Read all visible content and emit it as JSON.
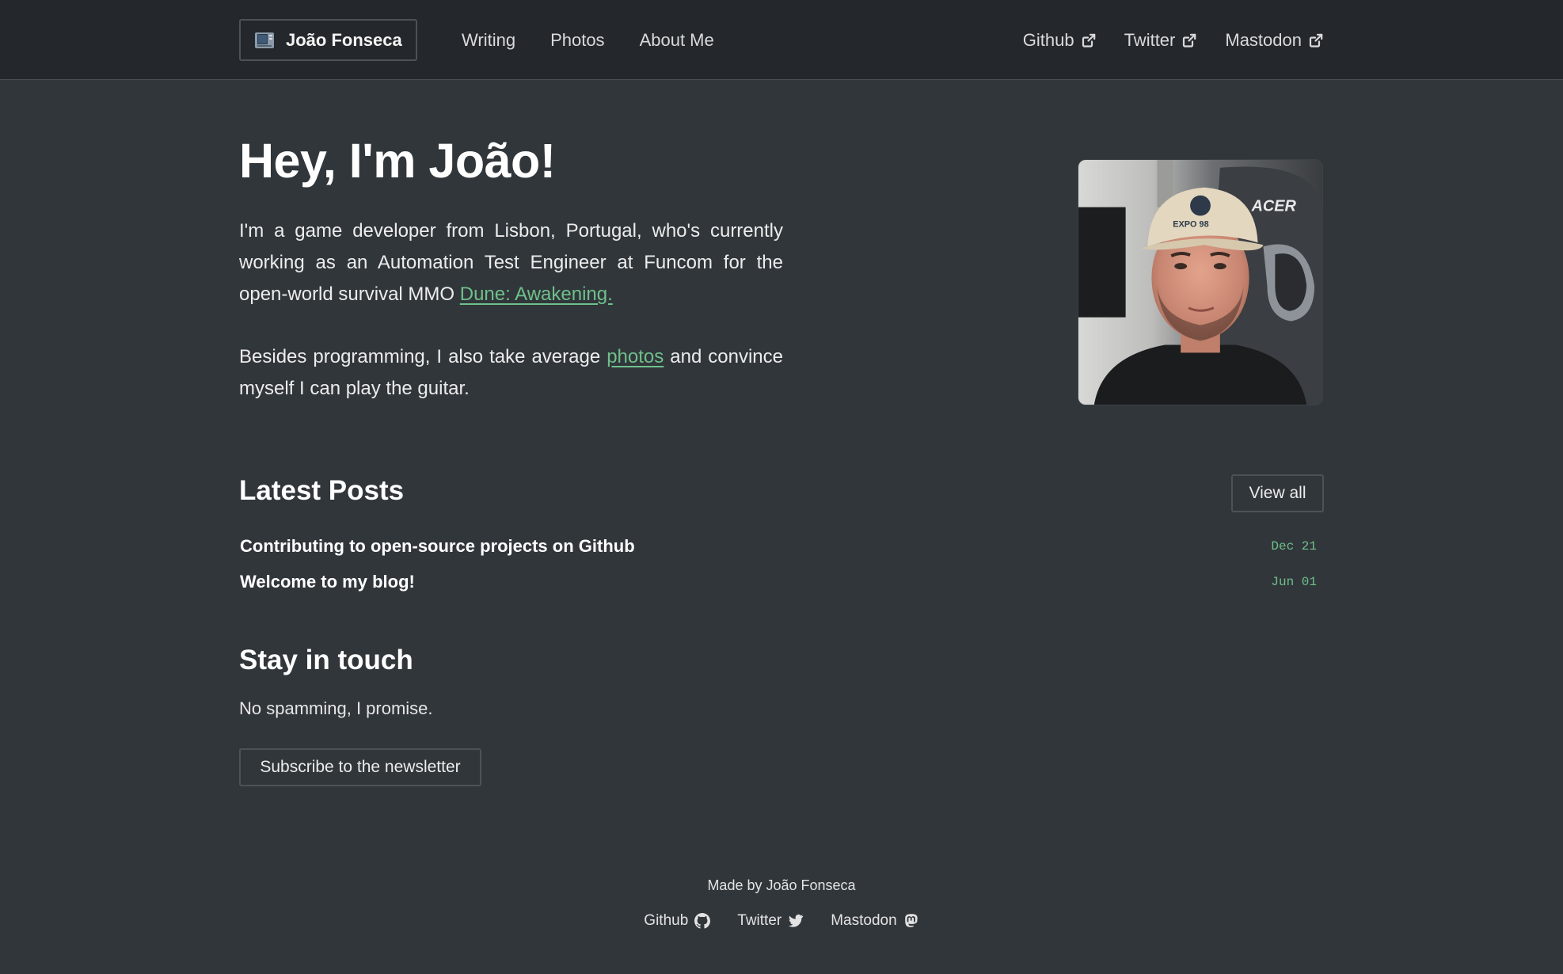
{
  "header": {
    "brand_name": "João Fonseca",
    "brand_icon": "retro-computer-icon",
    "nav_left": [
      {
        "label": "Writing"
      },
      {
        "label": "Photos"
      },
      {
        "label": "About Me"
      }
    ],
    "nav_right": [
      {
        "label": "Github",
        "icon": "external-link-icon"
      },
      {
        "label": "Twitter",
        "icon": "external-link-icon"
      },
      {
        "label": "Mastodon",
        "icon": "external-link-icon"
      }
    ]
  },
  "hero": {
    "title": "Hey, I'm João!",
    "intro_text": "I'm a game developer from Lisbon, Portugal, who's currently working as an Automation Test Engineer at Funcom for the open-world survival MMO ",
    "intro_link": "Dune: Awakening.",
    "hobby_text_before": "Besides programming, I also take average ",
    "hobby_link": "photos",
    "hobby_text_after": " and convince myself I can play the guitar."
  },
  "latest_posts": {
    "title": "Latest Posts",
    "view_all_label": "View all",
    "posts": [
      {
        "title": "Contributing to open-source projects on Github",
        "date": "Dec 21"
      },
      {
        "title": "Welcome to my blog!",
        "date": "Jun 01"
      }
    ]
  },
  "stay_in_touch": {
    "title": "Stay in touch",
    "text": "No spamming, I promise.",
    "button_label": "Subscribe to the newsletter"
  },
  "footer": {
    "credit": "Made by João Fonseca",
    "links": [
      {
        "label": "Github",
        "icon": "github-icon"
      },
      {
        "label": "Twitter",
        "icon": "twitter-icon"
      },
      {
        "label": "Mastodon",
        "icon": "mastodon-icon"
      }
    ]
  },
  "colors": {
    "background": "#31363b",
    "header_background": "#24282c",
    "accent_green": "#6fc08a",
    "border": "#4d5257"
  }
}
